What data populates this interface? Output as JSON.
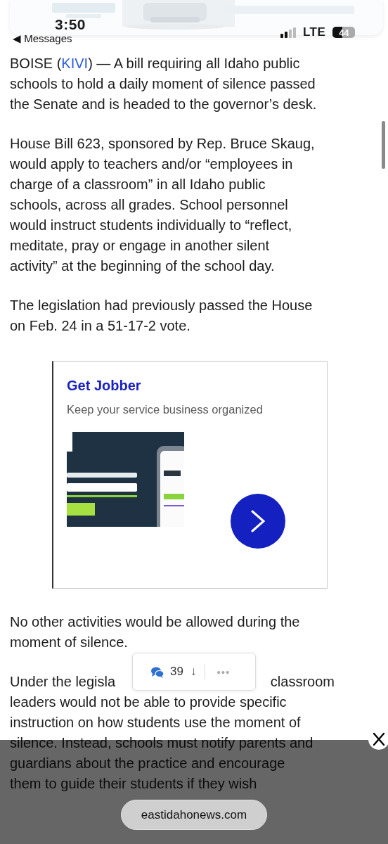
{
  "status_bar": {
    "time": "3:50",
    "back_label": "◀ Messages",
    "network": "LTE",
    "battery": "44"
  },
  "article": {
    "blocks": [
      {
        "kind": "lead",
        "before": "BOISE (",
        "link": "KIVI",
        "lines": [
          ") — A bill requiring all Idaho public",
          "schools to hold a daily moment of silence passed",
          "the Senate and is headed to the governor’s desk."
        ]
      },
      {
        "kind": "paragraph",
        "lines": [
          "House Bill 623, sponsored by Rep. Bruce Skaug,",
          "would apply to teachers and/or “employees in",
          "charge of a classroom” in all Idaho public",
          "schools, across all grades. School personnel",
          "would instruct students individually to “reflect,",
          "meditate, pray or engage in another silent",
          "activity” at the beginning of the school day."
        ]
      },
      {
        "kind": "paragraph",
        "lines": [
          "The legislation had previously passed the House",
          "on Feb. 24 in a 51-17-2 vote."
        ]
      },
      {
        "kind": "ad",
        "title": "Get Jobber",
        "subtitle": "Keep your service business organized"
      },
      {
        "kind": "paragraph",
        "lines": [
          "No other activities would be allowed during the",
          "moment of silence."
        ]
      },
      {
        "kind": "covered",
        "left": "Under the legisla",
        "right": "classroom",
        "lines": [
          "leaders would not be able to provide specific",
          "instruction on how students use the moment of",
          "silence. Instead, schools must notify parents and",
          "guardians about the practice and encourage",
          "them to guide their students if they wish"
        ]
      }
    ]
  },
  "comment_pill": {
    "count": "39",
    "sort_icon": "↓",
    "more": "•••"
  },
  "bottom_overlay": {
    "domain": "eastidahonews.com"
  }
}
